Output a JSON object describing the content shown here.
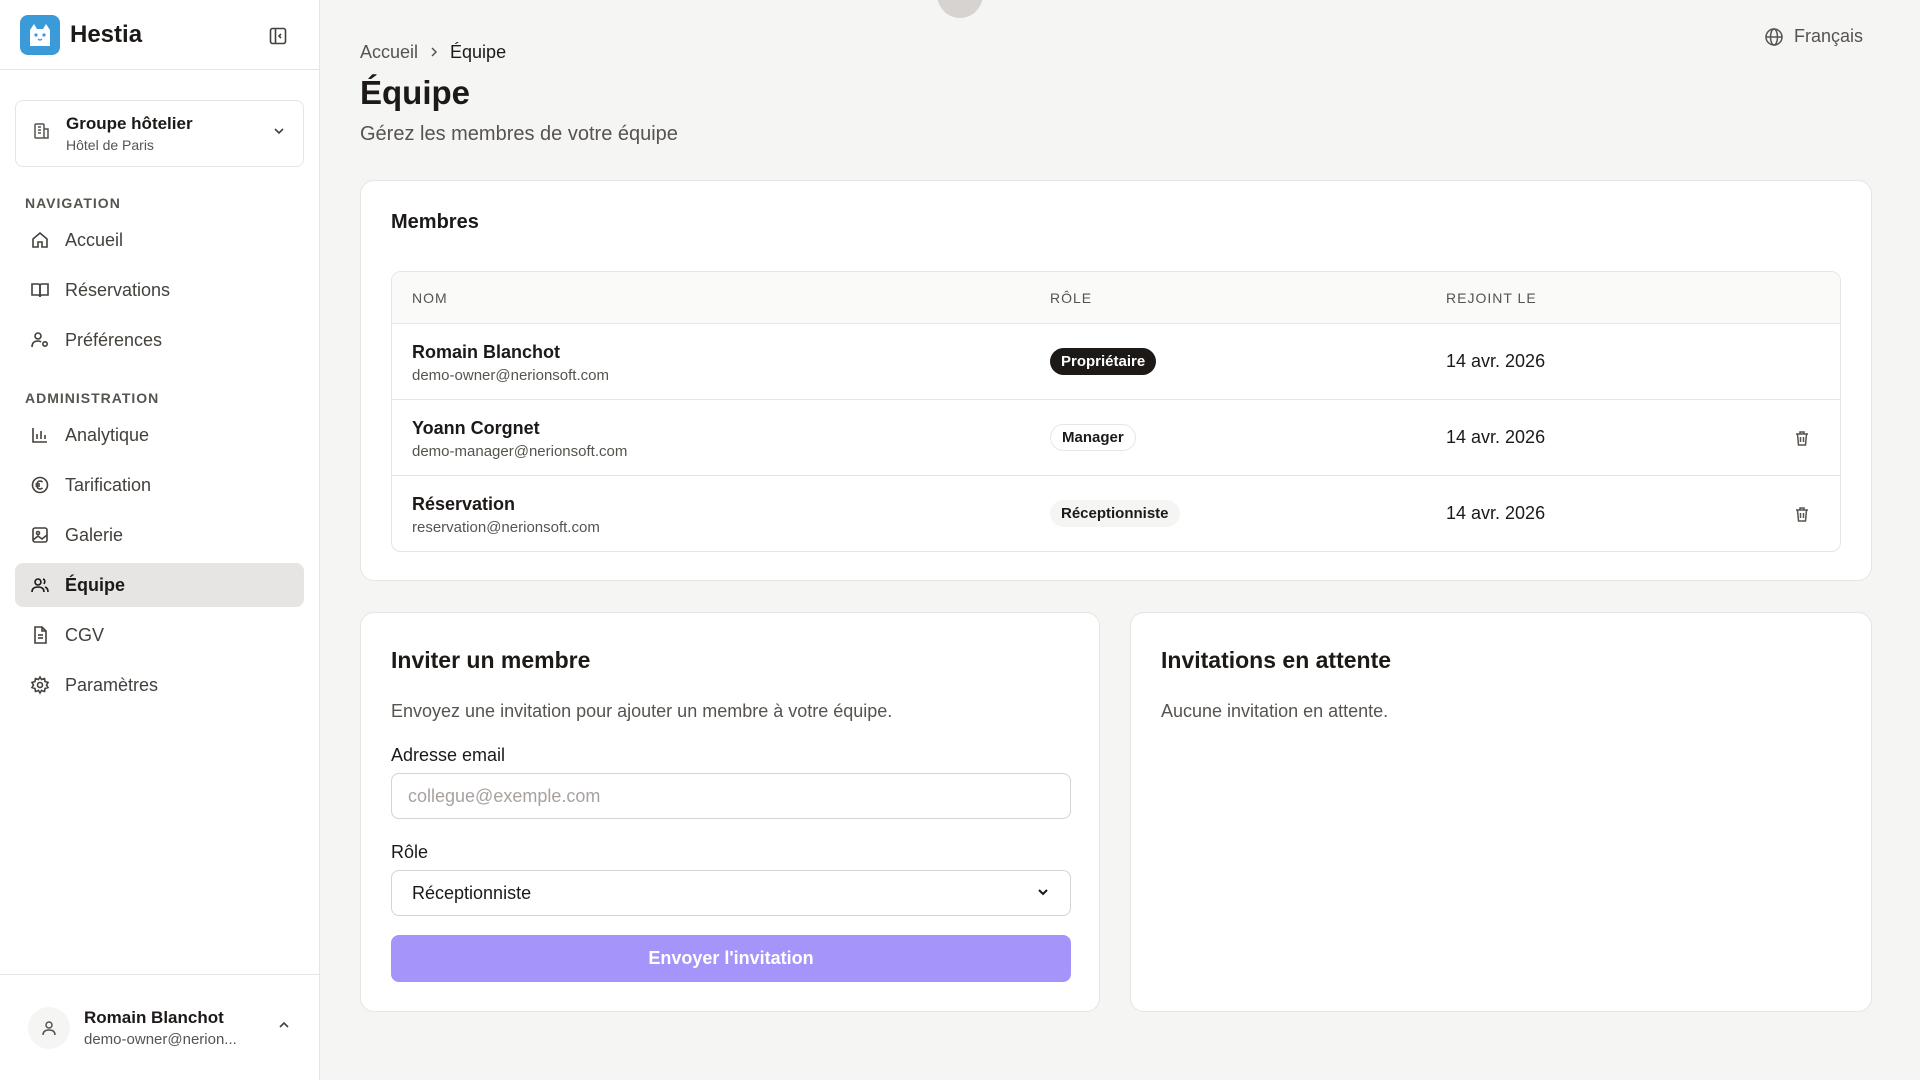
{
  "app": {
    "name": "Hestia"
  },
  "hotel": {
    "title": "Groupe hôtelier",
    "subtitle": "Hôtel de Paris"
  },
  "nav": {
    "section_nav": "NAVIGATION",
    "section_admin": "ADMINISTRATION",
    "items": [
      {
        "label": "Accueil",
        "icon": "home-icon"
      },
      {
        "label": "Réservations",
        "icon": "book-icon"
      },
      {
        "label": "Préférences",
        "icon": "user-settings-icon"
      },
      {
        "label": "Analytique",
        "icon": "bar-chart-icon"
      },
      {
        "label": "Tarification",
        "icon": "euro-icon"
      },
      {
        "label": "Galerie",
        "icon": "image-icon"
      },
      {
        "label": "Équipe",
        "icon": "users-icon",
        "active": true
      },
      {
        "label": "CGV",
        "icon": "file-text-icon"
      },
      {
        "label": "Paramètres",
        "icon": "gear-icon"
      }
    ]
  },
  "user": {
    "name": "Romain Blanchot",
    "email": "demo-owner@nerion..."
  },
  "lang": {
    "label": "Français"
  },
  "breadcrumb": {
    "home": "Accueil",
    "current": "Équipe"
  },
  "page": {
    "title": "Équipe",
    "subtitle": "Gérez les membres de votre équipe"
  },
  "members": {
    "title": "Membres",
    "columns": [
      "NOM",
      "RÔLE",
      "REJOINT LE"
    ],
    "rows": [
      {
        "name": "Romain Blanchot",
        "email": "demo-owner@nerionsoft.com",
        "role": "Propriétaire",
        "joined": "14 avr. 2026"
      },
      {
        "name": "Yoann Corgnet",
        "email": "demo-manager@nerionsoft.com",
        "role": "Manager",
        "joined": "14 avr. 2026"
      },
      {
        "name": "Réservation",
        "email": "reservation@nerionsoft.com",
        "role": "Réceptionniste",
        "joined": "14 avr. 2026"
      }
    ]
  },
  "invite": {
    "title": "Inviter un membre",
    "description": "Envoyez une invitation pour ajouter un membre à votre équipe.",
    "email_label": "Adresse email",
    "email_placeholder": "collegue@exemple.com",
    "role_label": "Rôle",
    "role_value": "Réceptionniste",
    "submit": "Envoyer l'invitation"
  },
  "pending": {
    "title": "Invitations en attente",
    "empty": "Aucune invitation en attente."
  },
  "colors": {
    "accent": "#a594f9",
    "brand": "#3b9bd9",
    "owner_badge": "#1c1917"
  }
}
